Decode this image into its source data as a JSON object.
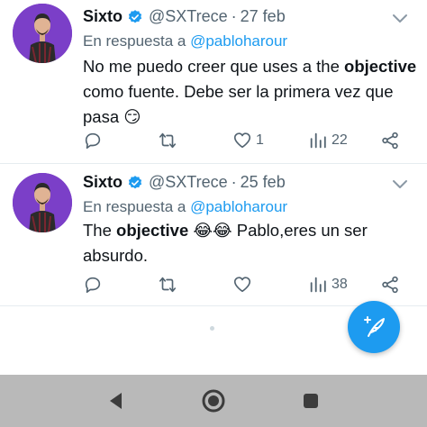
{
  "tweets": [
    {
      "name": "Sixto",
      "handle": "@SXTrece",
      "separator": "·",
      "date": "27 feb",
      "reply_prefix": "En respuesta a",
      "reply_to": "@pabloharour",
      "text_before": "No me puedo creer que uses a the ",
      "text_bold": "objective",
      "text_after": " como fuente. Debe ser la primera vez que pasa 😏",
      "replies": "",
      "retweets": "",
      "likes": "1",
      "views": "22"
    },
    {
      "name": "Sixto",
      "handle": "@SXTrece",
      "separator": "·",
      "date": "25 feb",
      "reply_prefix": "En respuesta a",
      "reply_to": "@pabloharour",
      "text_before": "The ",
      "text_bold": "objective",
      "text_after": " 😂😂 Pablo,eres un ser absurdo.",
      "replies": "",
      "retweets": "",
      "likes": "",
      "views": "38"
    }
  ],
  "icons": {
    "verified": "verified-badge-icon",
    "more": "more-icon",
    "reply": "reply-icon",
    "retweet": "retweet-icon",
    "like": "heart-icon",
    "views": "views-icon",
    "share": "share-icon",
    "compose": "compose-icon",
    "nav_back": "back-triangle-icon",
    "nav_home": "home-circle-icon",
    "nav_recent": "recents-square-icon"
  },
  "colors": {
    "accent": "#1d9bf0",
    "text": "#0f1419",
    "secondary": "#536471",
    "navbar": "#b9b9b9",
    "avatar_bg": "#7b3fc8"
  }
}
